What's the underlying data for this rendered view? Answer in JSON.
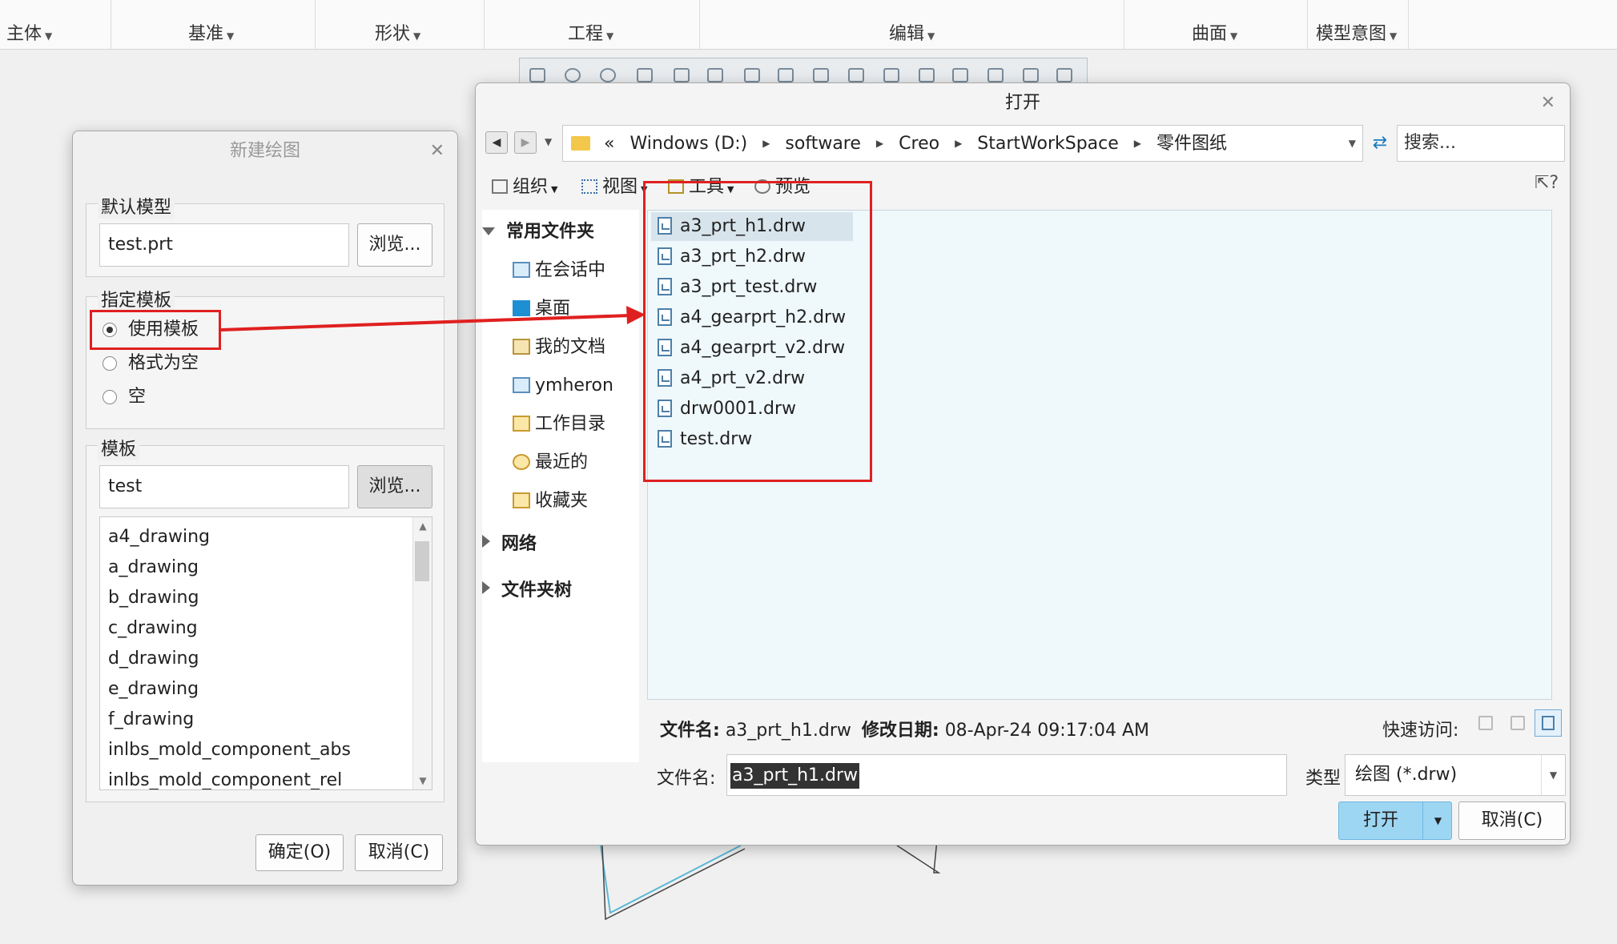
{
  "ribbon": {
    "tabs": [
      {
        "label": "主体"
      },
      {
        "label": "基准"
      },
      {
        "label": "形状"
      },
      {
        "label": "工程"
      },
      {
        "label": "编辑"
      },
      {
        "label": "曲面"
      },
      {
        "label": "模型意图"
      }
    ]
  },
  "new_drawing": {
    "title": "新建绘图",
    "default_model_legend": "默认模型",
    "default_model_value": "test.prt",
    "browse_label": "浏览...",
    "template_spec_legend": "指定模板",
    "radios": [
      {
        "label": "使用模板",
        "checked": true
      },
      {
        "label": "格式为空",
        "checked": false
      },
      {
        "label": "空",
        "checked": false
      }
    ],
    "template_legend": "模板",
    "template_value": "test",
    "templates": [
      "a4_drawing",
      "a_drawing",
      "b_drawing",
      "c_drawing",
      "d_drawing",
      "e_drawing",
      "f_drawing",
      "inlbs_mold_component_abs",
      "inlbs_mold_component_rel"
    ],
    "ok_label": "确定(O)",
    "cancel_label": "取消(C)"
  },
  "open_dialog": {
    "title": "打开",
    "breadcrumb": [
      "«",
      "Windows (D:)",
      "software",
      "Creo",
      "StartWorkSpace",
      "零件图纸"
    ],
    "search_placeholder": "搜索...",
    "commands": [
      "组织",
      "视图",
      "工具",
      "预览"
    ],
    "help_icon_text": "?",
    "tree": {
      "favorites": "常用文件夹",
      "items": [
        "在会话中",
        "桌面",
        "我的文档",
        "ymheron",
        "工作目录",
        "最近的",
        "收藏夹"
      ],
      "network": "网络",
      "folder_tree": "文件夹树"
    },
    "files": [
      "a3_prt_h1.drw",
      "a3_prt_h2.drw",
      "a3_prt_test.drw",
      "a4_gearprt_h2.drw",
      "a4_gearprt_v2.drw",
      "a4_prt_v2.drw",
      "drw0001.drw",
      "test.drw"
    ],
    "selected_file_index": 0,
    "status": {
      "name_label": "文件名:",
      "name_value": "a3_prt_h1.drw",
      "date_label": "修改日期:",
      "date_value": "08-Apr-24 09:17:04 AM"
    },
    "quick_access_label": "快速访问:",
    "filename_label": "文件名:",
    "filename_value": "a3_prt_h1.drw",
    "type_label": "类型",
    "type_value": "绘图 (*.drw)",
    "open_label": "打开",
    "cancel_label": "取消(C)"
  },
  "colors": {
    "annotation": "#e02020",
    "accent_button": "#9dd6f3",
    "file_pane": "#eff8fb"
  }
}
